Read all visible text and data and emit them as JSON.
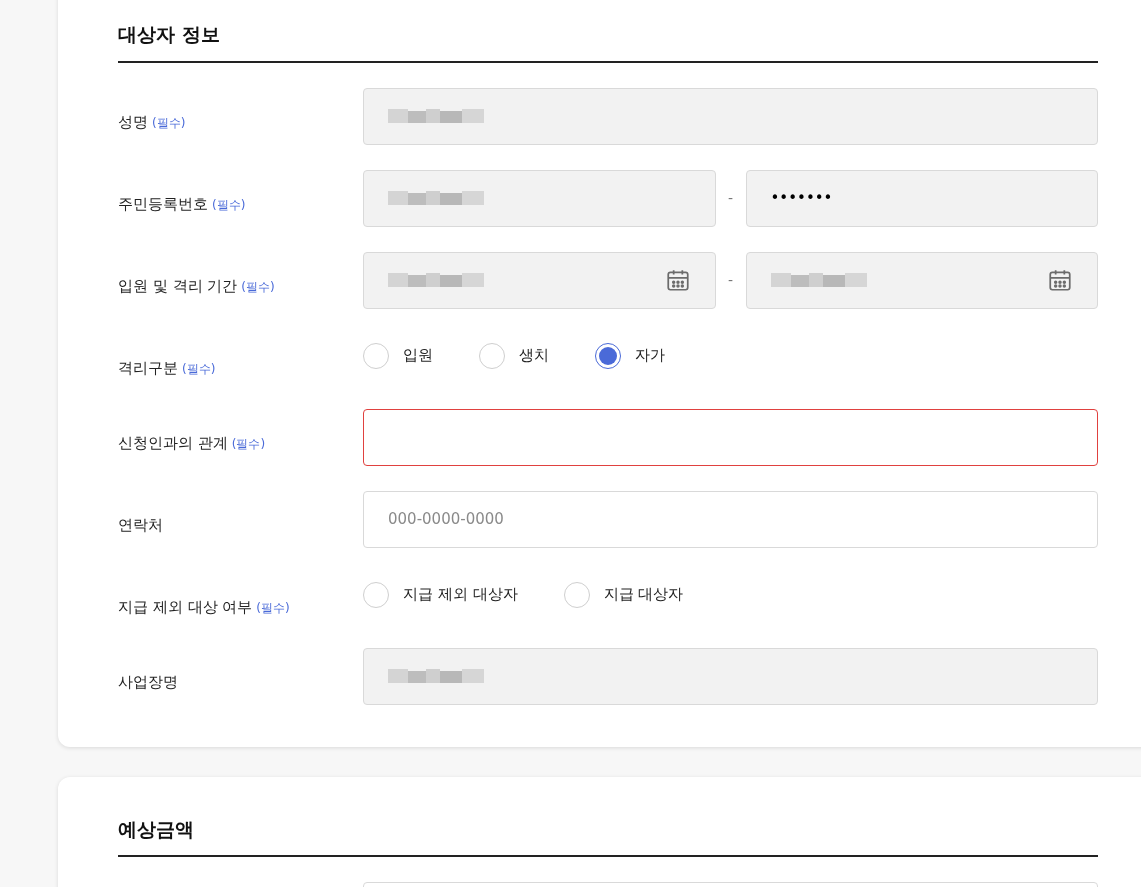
{
  "sections": [
    {
      "title": "대상자 정보",
      "fields": [
        {
          "label": "성명",
          "required": "(필수)",
          "kind": "single",
          "parts": [
            {
              "redacted": true,
              "disabled": true
            }
          ]
        },
        {
          "label": "주민등록번호",
          "required": "(필수)",
          "kind": "pair",
          "separator": "-",
          "parts": [
            {
              "redacted": true,
              "disabled": true
            },
            {
              "value": "•••••••",
              "disabled": true
            }
          ]
        },
        {
          "label": "입원 및 격리 기간",
          "required": "(필수)",
          "kind": "date_range",
          "separator": "-",
          "parts": [
            {
              "redacted": true,
              "disabled": true
            },
            {
              "redacted": true,
              "disabled": true
            }
          ]
        },
        {
          "label": "격리구분",
          "required": "(필수)",
          "kind": "radio",
          "options": [
            {
              "label": "입원",
              "selected": false
            },
            {
              "label": "생치",
              "selected": false
            },
            {
              "label": "자가",
              "selected": true
            }
          ]
        },
        {
          "label": "신청인과의 관계",
          "required": "(필수)",
          "kind": "single",
          "parts": [
            {
              "error": true,
              "disabled": false
            }
          ]
        },
        {
          "label": "연락처",
          "kind": "single",
          "parts": [
            {
              "placeholder": "000-0000-0000",
              "disabled": false
            }
          ]
        },
        {
          "label": "지급 제외 대상 여부",
          "required": "(필수)",
          "kind": "radio",
          "options": [
            {
              "label": "지급 제외 대상자",
              "selected": false
            },
            {
              "label": "지급 대상자",
              "selected": false
            }
          ]
        },
        {
          "label": "사업장명",
          "kind": "single",
          "parts": [
            {
              "redacted": true,
              "disabled": true
            }
          ]
        }
      ]
    },
    {
      "title": "예상금액",
      "fields": [
        {
          "kind": "single",
          "parts": [
            {
              "disabled": false
            }
          ]
        }
      ]
    }
  ]
}
